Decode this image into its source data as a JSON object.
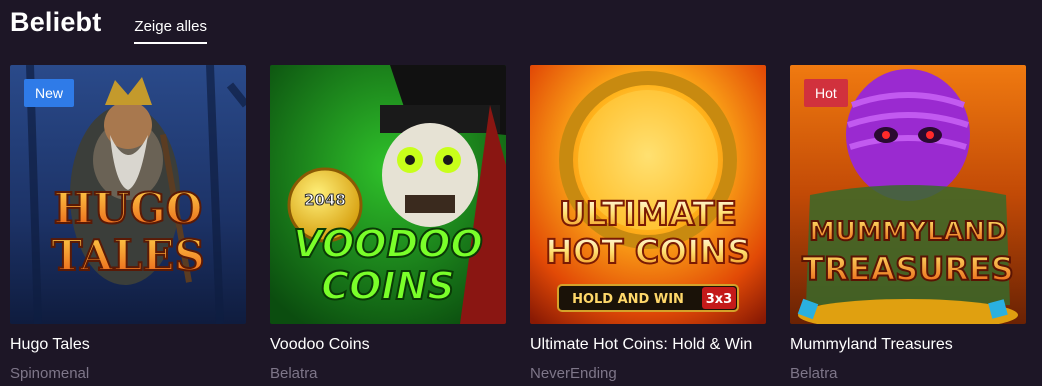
{
  "section": {
    "title": "Beliebt",
    "show_all_label": "Zeige alles"
  },
  "games": [
    {
      "name": "Hugo Tales",
      "provider": "Spinomenal",
      "badge": "New",
      "thumb_title": [
        "HUGO",
        "TALES"
      ]
    },
    {
      "name": "Voodoo Coins",
      "provider": "Belatra",
      "badge": "",
      "thumb_title": [
        "VOODOO",
        "COINS"
      ],
      "coin_text": "2048"
    },
    {
      "name": "Ultimate Hot Coins: Hold & Win",
      "provider": "NeverEnding",
      "badge": "",
      "thumb_title": [
        "ULTIMATE",
        "HOT COINS"
      ],
      "thumb_sub": "HOLD AND WIN",
      "thumb_sub2": "3x3"
    },
    {
      "name": "Mummyland Treasures",
      "provider": "Belatra",
      "badge": "Hot",
      "thumb_title": [
        "MUMMYLAND",
        "TREASURES"
      ]
    }
  ],
  "colors": {
    "background": "#1d1626",
    "badge_new": "#2f7be8",
    "badge_hot": "#d1313d",
    "provider_text": "#7e7689"
  }
}
